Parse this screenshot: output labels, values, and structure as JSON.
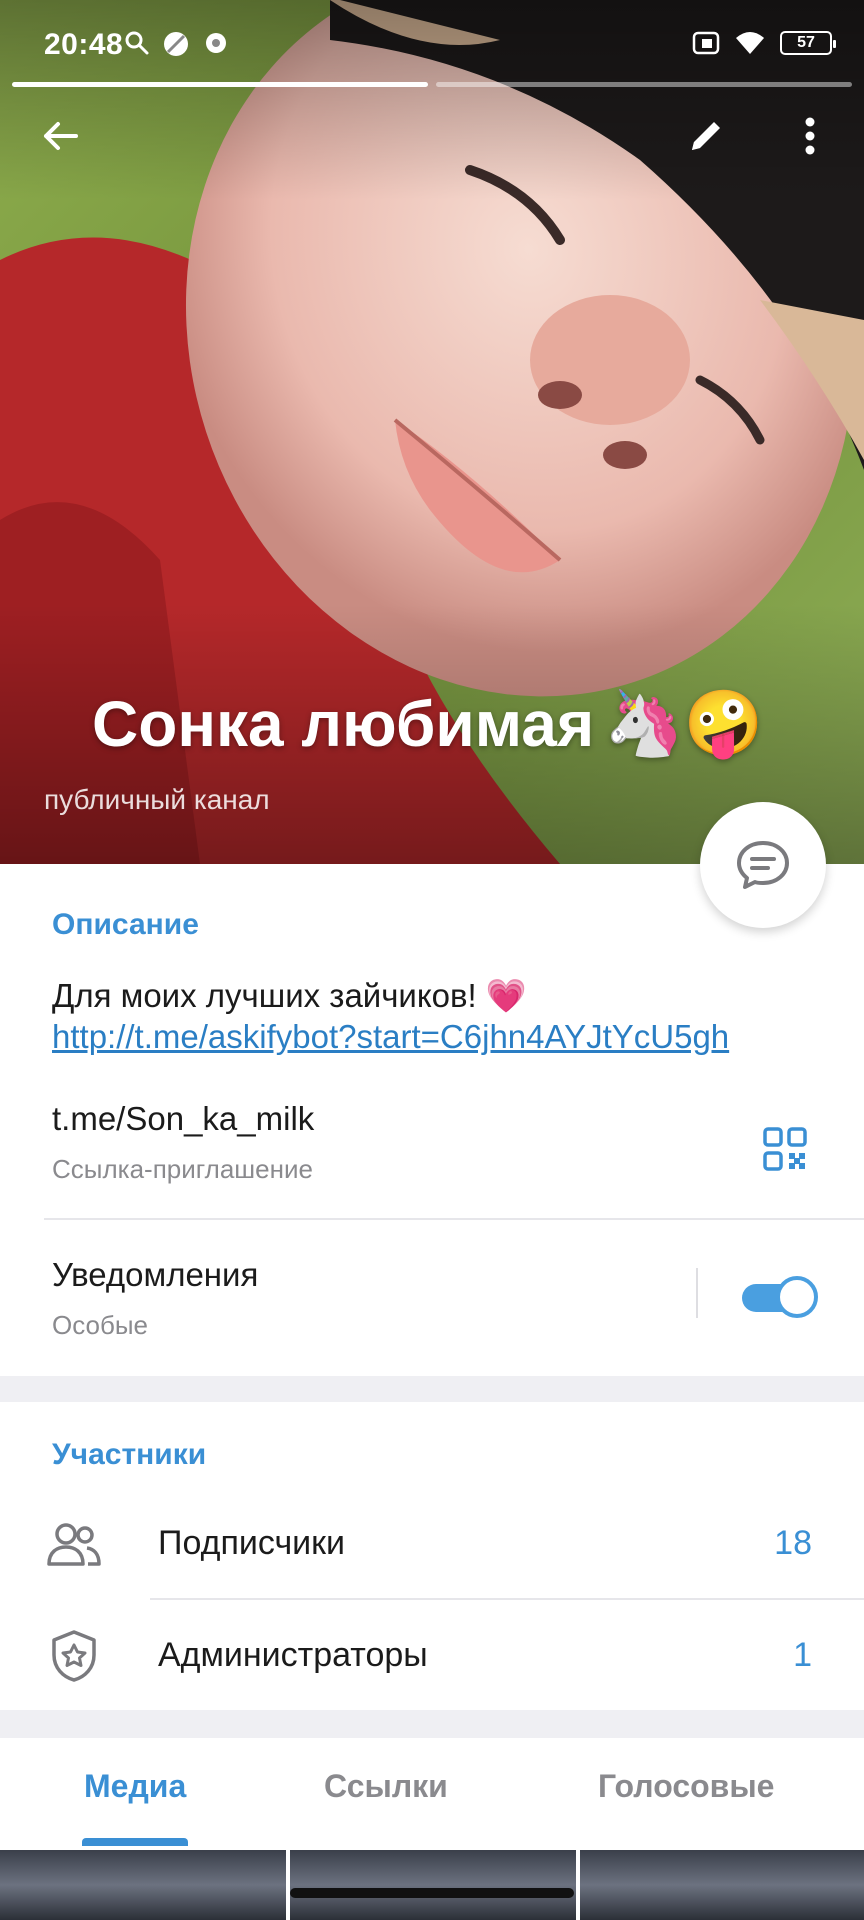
{
  "status_bar": {
    "time": "20:48",
    "battery": "57",
    "icons": [
      "search-icon",
      "moon-icon",
      "chat-bubble-icon",
      "sim-icon",
      "wifi-icon",
      "battery-icon"
    ]
  },
  "header": {
    "channel_name": "Сонка любимая",
    "emojis": "🦄🤪",
    "channel_type": "публичный канал",
    "story_progress": [
      1,
      0
    ]
  },
  "info": {
    "description_title": "Описание",
    "description_text": "Для моих лучших зайчиков! 💗",
    "description_link": "http://t.me/askifybot?start=C6jhn4AYJtYcU5gh",
    "invite_link": "t.me/Son_ka_milk",
    "invite_link_label": "Ссылка-приглашение",
    "notifications_label": "Уведомления",
    "notifications_value": "Особые",
    "notifications_enabled": true
  },
  "members": {
    "title": "Участники",
    "rows": [
      {
        "label": "Подписчики",
        "count": "18",
        "icon": "people-icon"
      },
      {
        "label": "Администраторы",
        "count": "1",
        "icon": "admin-shield-icon"
      }
    ]
  },
  "tabs": {
    "items": [
      "Медиа",
      "Ссылки",
      "Голосовые"
    ],
    "active": "Медиа"
  },
  "colors": {
    "accent": "#3a8fd4",
    "link": "#2a7ec4",
    "secondary_text": "#8a8a8e"
  }
}
